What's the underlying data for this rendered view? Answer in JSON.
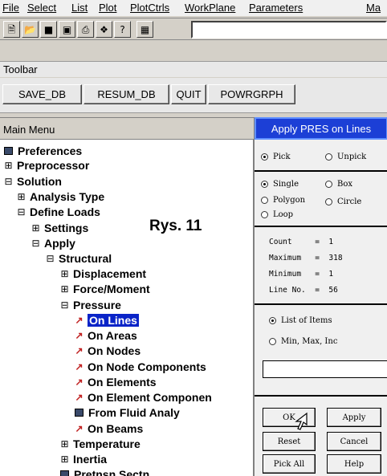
{
  "menubar": {
    "items": [
      "File",
      "Select",
      "List",
      "Plot",
      "PlotCtrls",
      "WorkPlane",
      "Parameters",
      "Ma"
    ]
  },
  "icon_toolbar": {
    "icons": [
      "new-file-icon",
      "open-folder-icon",
      "save-icon",
      "cube-icon",
      "print-icon",
      "paint-icon",
      "help-icon",
      "calculator-icon"
    ]
  },
  "toolbar": {
    "title": "Toolbar",
    "buttons": [
      "SAVE_DB",
      "RESUM_DB",
      "QUIT",
      "POWRGRPH"
    ]
  },
  "main_menu": {
    "title": "Main Menu",
    "items": [
      {
        "label": "Preferences",
        "expander": "▣",
        "kind": "square"
      },
      {
        "label": "Preprocessor",
        "expander": "⊞"
      },
      {
        "label": "Solution",
        "expander": "⊟"
      },
      {
        "label": "Analysis Type",
        "expander": "⊞"
      },
      {
        "label": "Define Loads",
        "expander": "⊟"
      },
      {
        "label": "Settings",
        "expander": "⊞"
      },
      {
        "label": "Apply",
        "expander": "⊟"
      },
      {
        "label": "Structural",
        "expander": "⊟"
      },
      {
        "label": "Displacement",
        "expander": "⊞"
      },
      {
        "label": "Force/Moment",
        "expander": "⊞"
      },
      {
        "label": "Pressure",
        "expander": "⊟"
      },
      {
        "label": "On Lines",
        "kind": "arrow",
        "selected": true
      },
      {
        "label": "On Areas",
        "kind": "arrow"
      },
      {
        "label": "On Nodes",
        "kind": "arrow"
      },
      {
        "label": "On Node Components",
        "kind": "arrow"
      },
      {
        "label": "On Elements",
        "kind": "arrow"
      },
      {
        "label": "On Element Componen",
        "kind": "arrow"
      },
      {
        "label": "From Fluid Analy",
        "kind": "square"
      },
      {
        "label": "On Beams",
        "kind": "arrow"
      },
      {
        "label": "Temperature",
        "expander": "⊞"
      },
      {
        "label": "Inertia",
        "expander": "⊞"
      },
      {
        "label": "Pretnsn Sectn",
        "kind": "square"
      }
    ],
    "annotation": "Rys. 11"
  },
  "dialog": {
    "title": "Apply PRES on Lines",
    "pick": "Pick",
    "unpick": "Unpick",
    "single": "Single",
    "box": "Box",
    "polygon": "Polygon",
    "circle": "Circle",
    "loop": "Loop",
    "count_label": "Count",
    "count_value": "1",
    "maximum_label": "Maximum",
    "maximum_value": "318",
    "minimum_label": "Minimum",
    "minimum_value": "1",
    "lineno_label": "Line No.",
    "lineno_value": "56",
    "list_of_items": "List of Items",
    "min_max_inc": "Min, Max, Inc",
    "buttons": {
      "ok": "OK",
      "apply": "Apply",
      "reset": "Reset",
      "cancel": "Cancel",
      "pick_all": "Pick All",
      "help": "Help"
    }
  },
  "colors": {
    "title_bar": "#1c3fd6",
    "selection": "#0a24c8"
  }
}
